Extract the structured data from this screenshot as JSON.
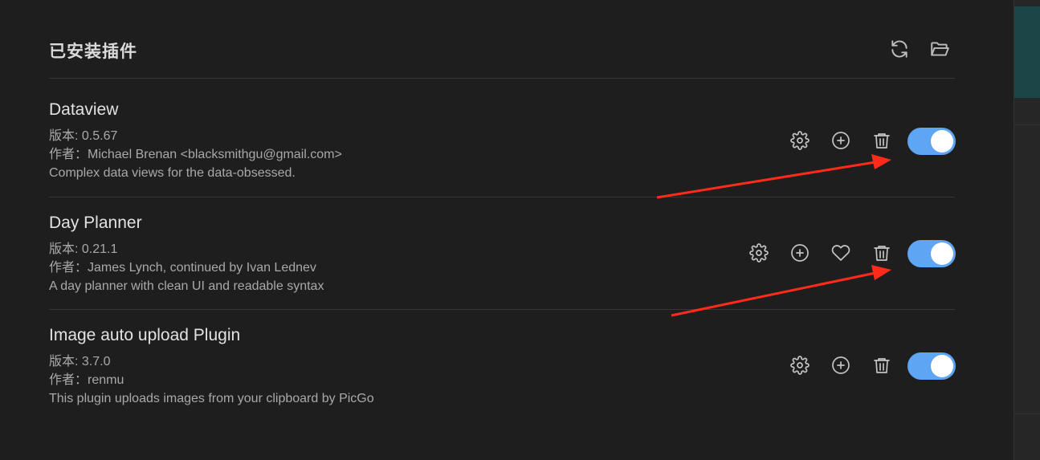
{
  "header": {
    "title": "已安装插件",
    "reload_icon": "refresh-icon",
    "folder_icon": "folder-open-icon"
  },
  "plugins": [
    {
      "name": "Dataview",
      "version": "版本: 0.5.67",
      "author": "作者：Michael Brenan <blacksmithgu@gmail.com>",
      "description": "Complex data views for the data-obsessed.",
      "actions": [
        "gear-icon",
        "plus-circle-icon",
        "trash-icon"
      ],
      "enabled": true
    },
    {
      "name": "Day Planner",
      "version": "版本: 0.21.1",
      "author": "作者：James Lynch, continued by Ivan Lednev",
      "description": "A day planner with clean UI and readable syntax",
      "actions": [
        "gear-icon",
        "plus-circle-icon",
        "heart-icon",
        "trash-icon"
      ],
      "enabled": true
    },
    {
      "name": "Image auto upload Plugin",
      "version": "版本: 3.7.0",
      "author": "作者：renmu",
      "description": "This plugin uploads images from your clipboard by PicGo",
      "actions": [
        "gear-icon",
        "plus-circle-icon",
        "trash-icon"
      ],
      "enabled": true
    }
  ],
  "colors": {
    "background": "#1e1e1e",
    "toggle_on": "#5ea6f3",
    "annotation_arrow": "#ff2a1a",
    "sidebar_accent": "#1c4548"
  }
}
